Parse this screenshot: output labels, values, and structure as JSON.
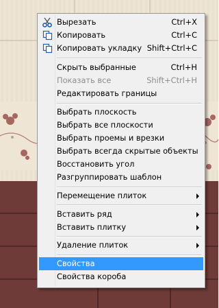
{
  "menu": {
    "cut": {
      "label": "Вырезать",
      "shortcut": "Ctrl+X",
      "icon": "scissors-icon"
    },
    "copy": {
      "label": "Копировать",
      "shortcut": "Ctrl+C",
      "icon": "copy-icon"
    },
    "copy_layout": {
      "label": "Копировать укладку",
      "shortcut": "Shift+Ctrl+C",
      "icon": "copy-layout-icon"
    },
    "hide_selected": {
      "label": "Скрыть выбранные",
      "shortcut": "Ctrl+H"
    },
    "show_all": {
      "label": "Показать все",
      "shortcut": "Shift+Ctrl+H",
      "disabled": true
    },
    "edit_borders": {
      "label": "Редактировать границы"
    },
    "select_plane": {
      "label": "Выбрать плоскость"
    },
    "select_all_planes": {
      "label": "Выбрать все плоскости"
    },
    "select_openings": {
      "label": "Выбрать проемы и врезки"
    },
    "select_hidden": {
      "label": "Выбрать всегда скрытые объекты"
    },
    "restore_angle": {
      "label": "Восстановить угол"
    },
    "ungroup_template": {
      "label": "Разгруппировать шаблон"
    },
    "move_tiles": {
      "label": "Перемещение плиток",
      "submenu": true
    },
    "insert_row": {
      "label": "Вставить ряд",
      "submenu": true
    },
    "insert_tile": {
      "label": "Вставить плитку",
      "submenu": true
    },
    "delete_tiles": {
      "label": "Удаление плиток",
      "submenu": true
    },
    "properties": {
      "label": "Свойства",
      "selected": true
    },
    "box_properties": {
      "label": "Свойства короба"
    }
  },
  "colors": {
    "menu_bg": "#f0f0f0",
    "selection": "#3399ff",
    "disabled_text": "#8d8d8d",
    "light_tile": "#ece3d2",
    "dark_tile": "#6e3b38"
  }
}
